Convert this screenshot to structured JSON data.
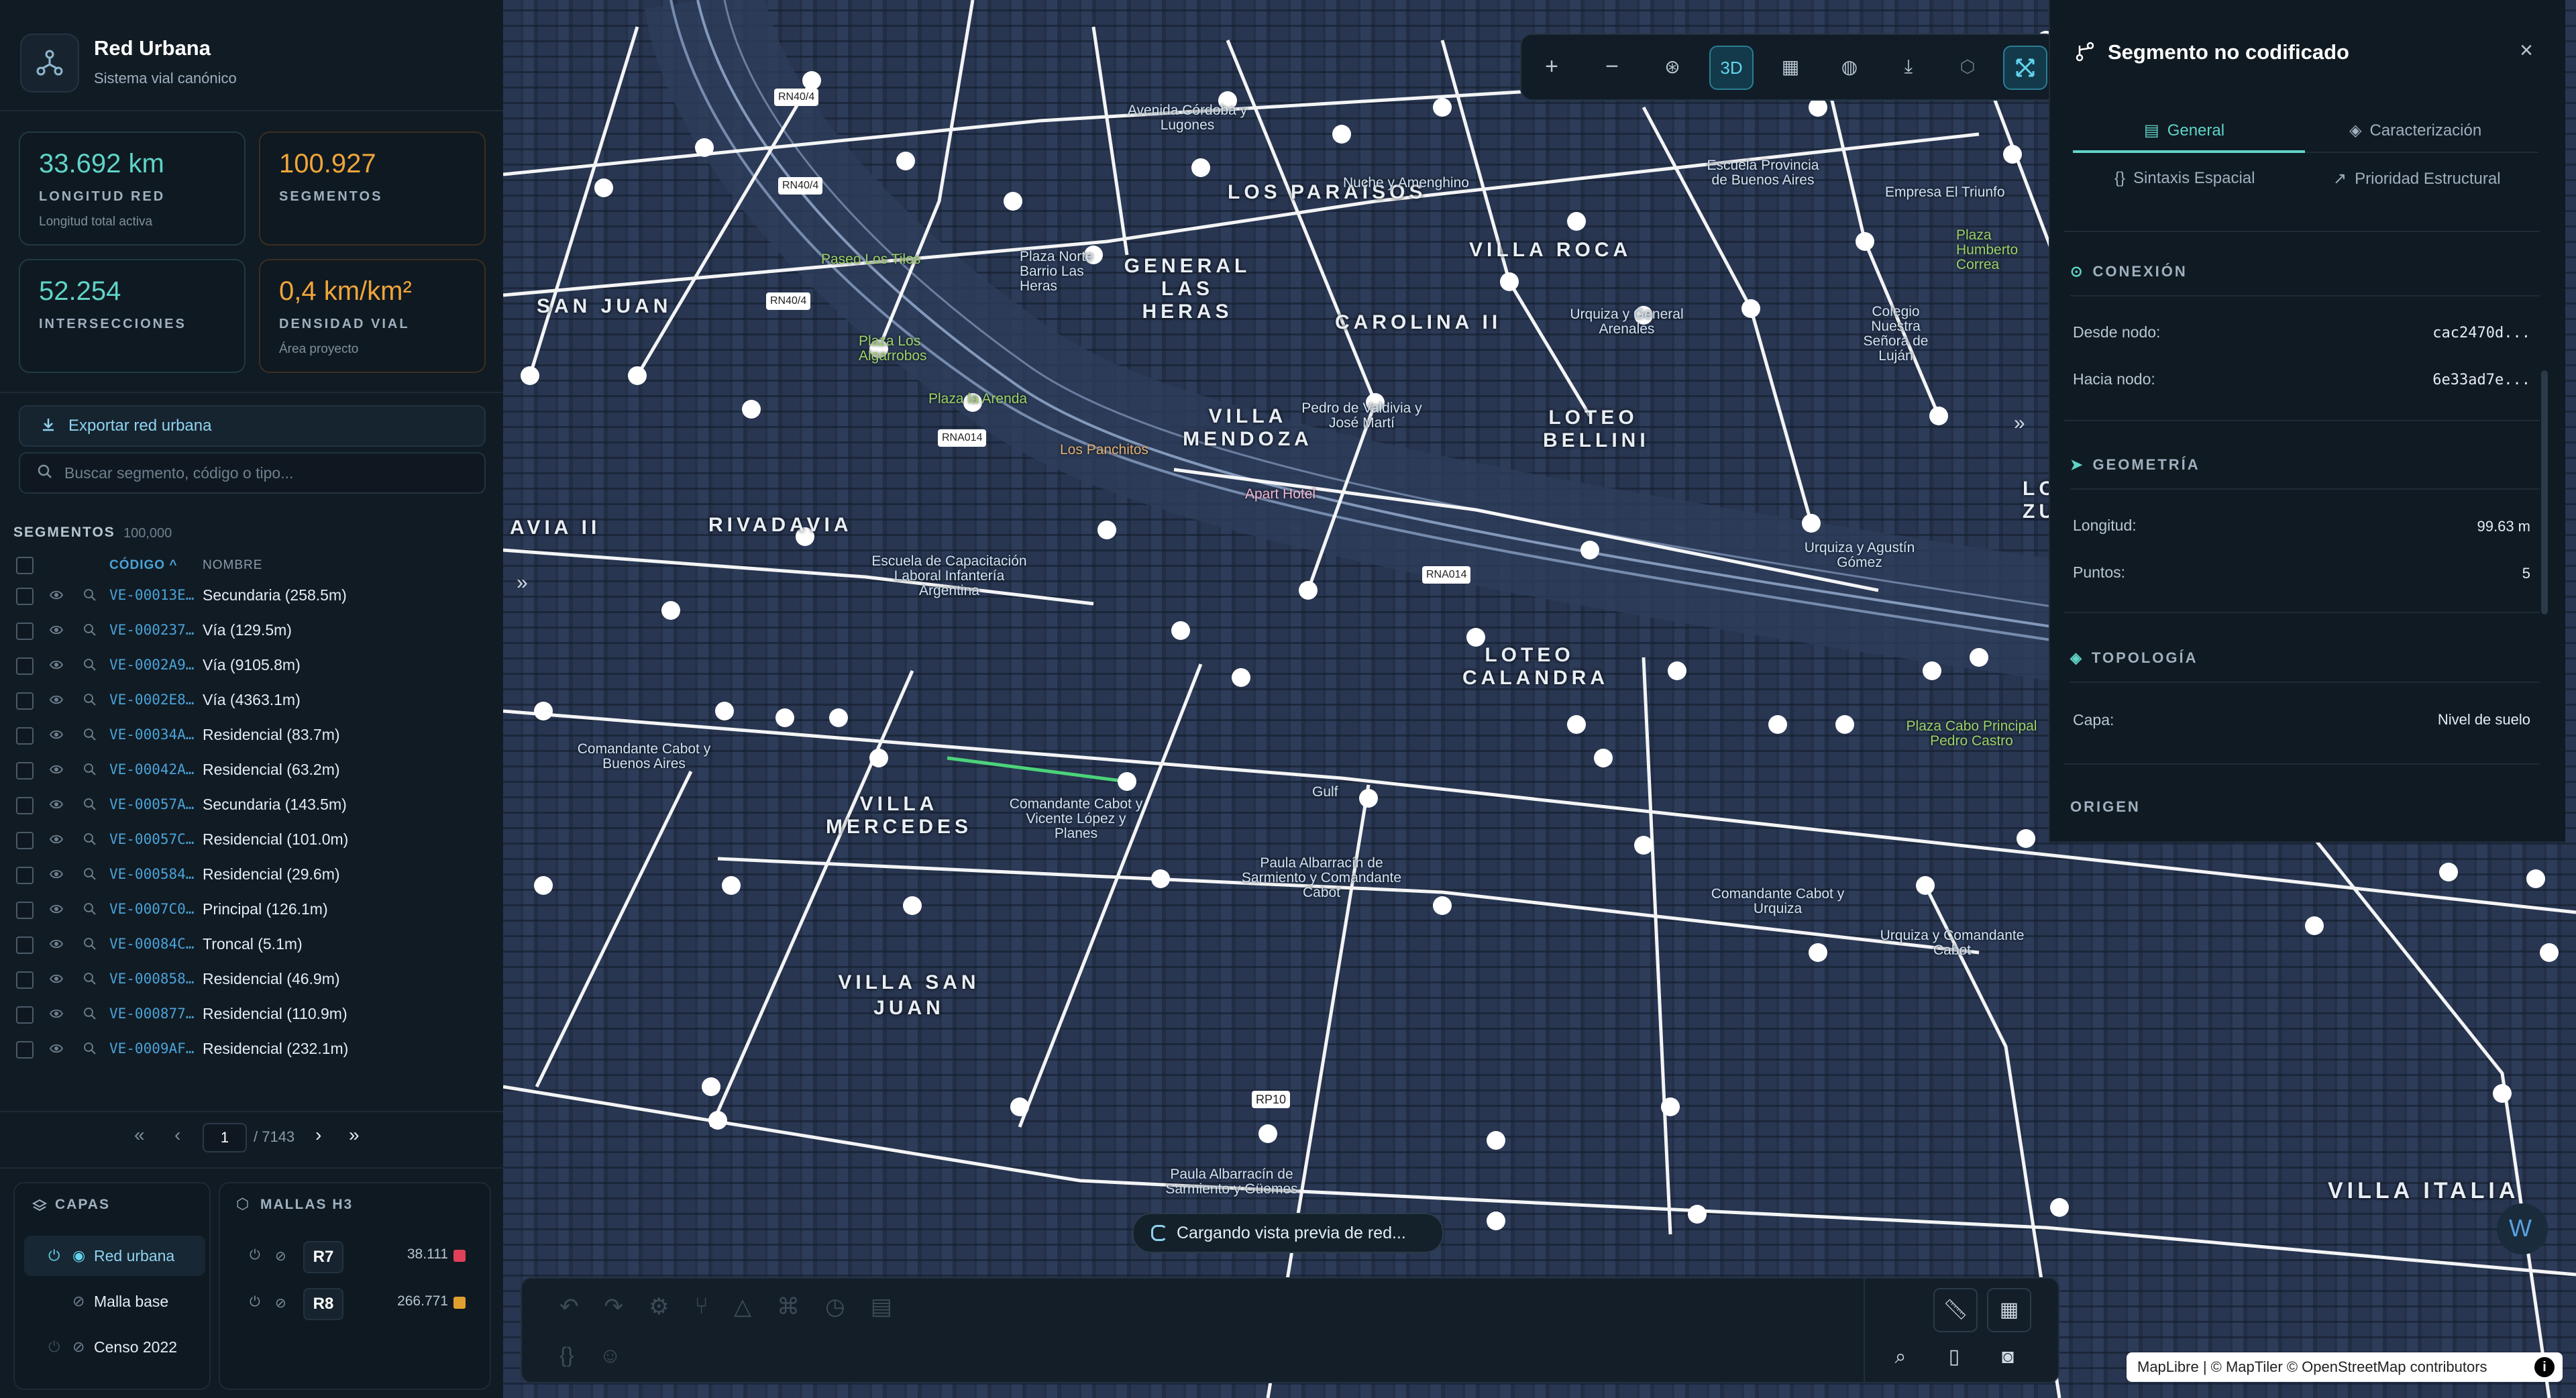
{
  "app": {
    "title": "Red Urbana",
    "subtitle": "Sistema vial canónico"
  },
  "stats": [
    {
      "value": "33.692 km",
      "label": "LONGITUD RED",
      "sub": "Longitud total activa"
    },
    {
      "value": "100.927",
      "label": "SEGMENTOS",
      "sub": ""
    },
    {
      "value": "52.254",
      "label": "INTERSECCIONES",
      "sub": ""
    },
    {
      "value": "0,4 km/km²",
      "label": "DENSIDAD VIAL",
      "sub": "Área proyecto"
    }
  ],
  "export_label": "Exportar red urbana",
  "search_placeholder": "Buscar segmento, código o tipo...",
  "segments": {
    "heading": "SEGMENTOS",
    "count": "100,000",
    "col_code": "CÓDIGO ^",
    "col_name": "NOMBRE",
    "rows": [
      {
        "code": "VE-00013E…",
        "name": "Secundaria (258.5m)"
      },
      {
        "code": "VE-000237…",
        "name": "Vía (129.5m)"
      },
      {
        "code": "VE-0002A9…",
        "name": "Vía (9105.8m)"
      },
      {
        "code": "VE-0002E8…",
        "name": "Vía (4363.1m)"
      },
      {
        "code": "VE-00034A…",
        "name": "Residencial (83.7m)"
      },
      {
        "code": "VE-00042A…",
        "name": "Residencial (63.2m)"
      },
      {
        "code": "VE-00057A…",
        "name": "Secundaria (143.5m)"
      },
      {
        "code": "VE-00057C…",
        "name": "Residencial (101.0m)"
      },
      {
        "code": "VE-000584…",
        "name": "Residencial (29.6m)"
      },
      {
        "code": "VE-0007C0…",
        "name": "Principal (126.1m)"
      },
      {
        "code": "VE-00084C…",
        "name": "Troncal (5.1m)"
      },
      {
        "code": "VE-000858…",
        "name": "Residencial (46.9m)"
      },
      {
        "code": "VE-000877…",
        "name": "Residencial (110.9m)"
      },
      {
        "code": "VE-0009AF…",
        "name": "Residencial (232.1m)"
      }
    ]
  },
  "pager": {
    "current": "1",
    "total": "/ 7143"
  },
  "layers": {
    "title": "CAPAS",
    "items": [
      "Red urbana",
      "Malla base",
      "Censo 2022"
    ]
  },
  "meshes": {
    "title": "MALLAS H3",
    "items": [
      {
        "label": "R7",
        "count": "38.111",
        "color": "#e0405a"
      },
      {
        "label": "R8",
        "count": "266.771",
        "color": "#e0a030"
      }
    ]
  },
  "map": {
    "districts": [
      "SAN JUAN",
      "LOS PARAÍSOS",
      "GENERAL LAS HERAS",
      "VILLA ROCA",
      "CAROLINA II",
      "VILLA MENDOZA",
      "LOTEO BELLINI",
      "LO ZUN",
      "AVIA II",
      "RIVADAVIA",
      "LOTEO CALANDRA",
      "VILLA MERCEDES",
      "VILLA SAN JUAN",
      "VILLA ITALIA"
    ],
    "roads": [
      "RN40/4",
      "RN40/4",
      "RN40/4",
      "RNA014",
      "RNA014",
      "RP10"
    ],
    "pois": [
      "Paseo Los Tilos",
      "Plaza Norte Barrio Las Heras",
      "Plaza Los Algarrobos",
      "Plaza la Arenda",
      "Los Panchitos",
      "Escuela de Capacitación Laboral Infantería Argentina",
      "Comandante Cabot y Buenos Aires",
      "Comandante Cabot y Vicente López y Planes",
      "Paula Albarracín de Sarmiento y Comandante Cabot",
      "Gulf",
      "Apart Hotel",
      "Pedro de Valdivia y José Martí",
      "Urquiza y Agustín Gómez",
      "Plaza Cabo Principal Pedro Castro",
      "Comandante Cabot y Urquiza",
      "Urquiza y Comandante Cabot",
      "Paula Albarracín de Sarmiento y Güemes",
      "Nuche y Amenghino",
      "Escuela Provincia de Buenos Aires",
      "Colegio Nuestra Señora de Luján",
      "Empresa El Triunfo",
      "Avenida Córdoba y Lugones",
      "Urquiza y General Arenales",
      "Plaza Humberto Correa"
    ],
    "loading": "Cargando vista previa de red...",
    "attribution": "MapLibre | © MapTiler © OpenStreetMap contributors"
  },
  "toolbar": {
    "mode_3d": "3D"
  },
  "panel": {
    "title": "Segmento no codificado",
    "tabs": [
      "General",
      "Caracterización",
      "Sintaxis Espacial",
      "Prioridad Estructural"
    ],
    "conexion": {
      "heading": "CONEXIÓN",
      "from_label": "Desde nodo:",
      "from_value": "cac2470d...",
      "to_label": "Hacia nodo:",
      "to_value": "6e33ad7e..."
    },
    "geometria": {
      "heading": "GEOMETRÍA",
      "length_label": "Longitud:",
      "length_value": "99.63 m",
      "points_label": "Puntos:",
      "points_value": "5"
    },
    "topologia": {
      "heading": "TOPOLOGÍA",
      "layer_label": "Capa:",
      "layer_value": "Nivel de suelo"
    },
    "origen": {
      "heading": "ORIGEN"
    }
  }
}
